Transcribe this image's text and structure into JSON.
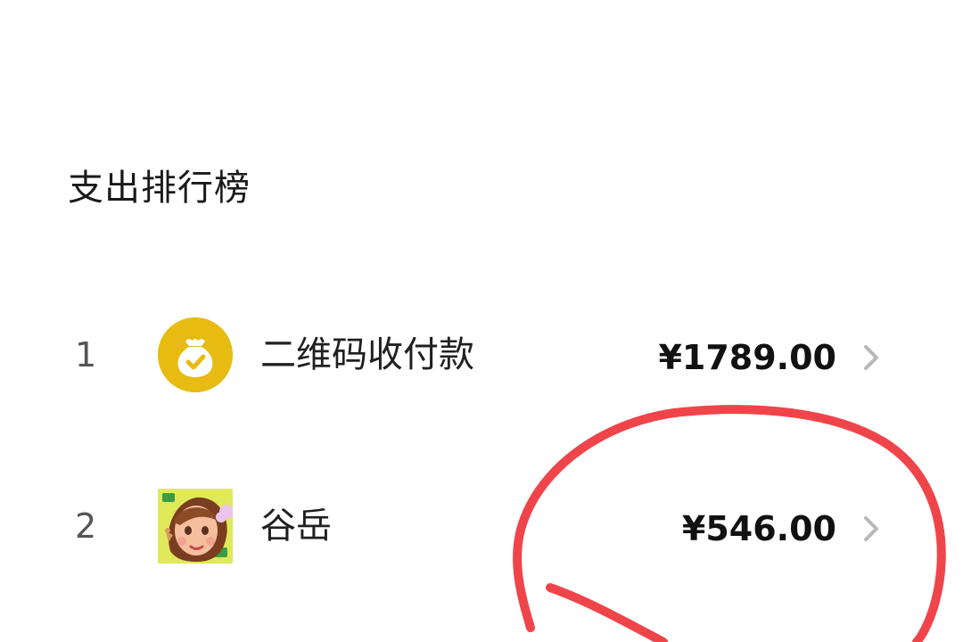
{
  "section": {
    "title": "支出排行榜"
  },
  "rankings": [
    {
      "rank": "1",
      "name": "二维码收付款",
      "amount": "¥1789.00",
      "icon": "money-bag-check-icon",
      "icon_color": "#E7BB12"
    },
    {
      "rank": "2",
      "name": "谷岳",
      "amount": "¥546.00",
      "icon": "cartoon-avatar"
    }
  ],
  "annotation": {
    "color": "#F0444B"
  }
}
